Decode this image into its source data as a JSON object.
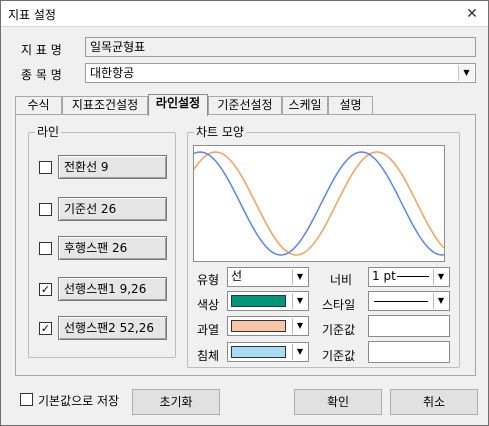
{
  "window": {
    "title": "지표 설정",
    "close_glyph": "✕"
  },
  "fields": {
    "indicator_label": "지 표 명",
    "indicator_value": "일목균형표",
    "stock_label": "종 목 명",
    "stock_value": "대한항공"
  },
  "tabs": [
    {
      "label": "수식",
      "active": false
    },
    {
      "label": "지표조건설정",
      "active": false
    },
    {
      "label": "라인설정",
      "active": true
    },
    {
      "label": "기준선설정",
      "active": false
    },
    {
      "label": "스케일",
      "active": false
    },
    {
      "label": "설명",
      "active": false
    }
  ],
  "line_group": {
    "title": "라인",
    "items": [
      {
        "label": "전환선 9",
        "checked": false
      },
      {
        "label": "기준선 26",
        "checked": false
      },
      {
        "label": "후행스팬 26",
        "checked": false
      },
      {
        "label": "선행스팬1 9,26",
        "checked": true
      },
      {
        "label": "선행스팬2 52,26",
        "checked": true
      }
    ]
  },
  "chart_group": {
    "title": "차트 모양",
    "preview_colors": {
      "orange": "#f4a15f",
      "blue": "#5b86e0"
    }
  },
  "properties": {
    "type_label": "유형",
    "type_value": "선",
    "width_label": "너비",
    "width_value": "1 pt",
    "color_label": "색상",
    "color_value": "#00967a",
    "style_label": "스타일",
    "over_label": "과열",
    "over_value": "#f7c5a8",
    "base1_label": "기준값",
    "base1_value": "",
    "sink_label": "침체",
    "sink_value": "#a8dcf5",
    "base2_label": "기준값",
    "base2_value": ""
  },
  "footer": {
    "save_default_label": "기본값으로 저장",
    "save_default_checked": false,
    "reset_label": "초기화",
    "ok_label": "확인",
    "cancel_label": "취소"
  }
}
